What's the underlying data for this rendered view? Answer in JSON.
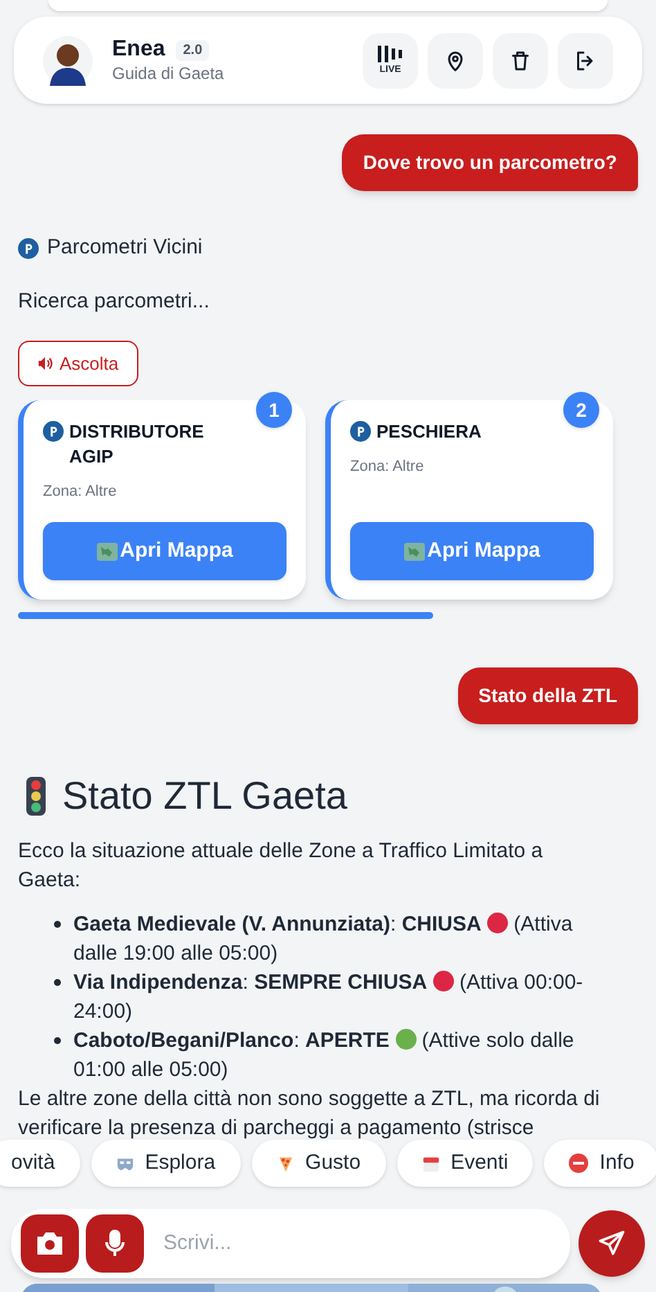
{
  "header": {
    "name": "Enea",
    "version": "2.0",
    "subtitle": "Guida di Gaeta",
    "live_label": "LIVE"
  },
  "messages": [
    {
      "kind": "user",
      "text": "Dove trovo un parcometro?"
    },
    {
      "kind": "parking",
      "title": "Parcometri Vicini",
      "status": "Ricerca parcometri...",
      "listen": "Ascolta",
      "cards": [
        {
          "number": "1",
          "name": "DISTRIBUTORE AGIP",
          "zone": "Zona: Altre",
          "button": "Apri Mappa"
        },
        {
          "number": "2",
          "name": "PESCHIERA",
          "zone": "Zona: Altre",
          "button": "Apri Mappa"
        }
      ]
    },
    {
      "kind": "user",
      "text": "Stato della ZTL"
    },
    {
      "kind": "ztl",
      "title": "Stato ZTL Gaeta",
      "intro": "Ecco la situazione attuale delle Zone a Traffico Limitato a Gaeta:",
      "items": [
        {
          "label": "**Gaeta Medievale (V. Annunziata)**: **CHIUSA**",
          "color": "#dc2644",
          "note": "(Attiva dalle 19:00 alle 05:00)"
        },
        {
          "label": "**Via Indipendenza**: **SEMPRE CHIUSA**",
          "color": "#dc2644",
          "note": "(Attiva 00:00-24:00)"
        },
        {
          "label": "**Caboto/Begani/Planco**: **APERTE**",
          "color": "#6ab04c",
          "note": "(Attive solo dalle 01:00 alle 05:00)"
        }
      ],
      "outro": "Le altre zone della città non sono soggette a ZTL, ma ricorda di verificare la presenza di parcheggi a pagamento (strisce"
    }
  ],
  "chips": [
    {
      "kind": "news",
      "label": "ovità"
    },
    {
      "kind": "explore",
      "label": "Esplora"
    },
    {
      "kind": "food",
      "label": "Gusto"
    },
    {
      "kind": "events",
      "label": "Eventi"
    },
    {
      "kind": "info",
      "label": "Info"
    }
  ],
  "input": {
    "placeholder": "Scrivi..."
  }
}
